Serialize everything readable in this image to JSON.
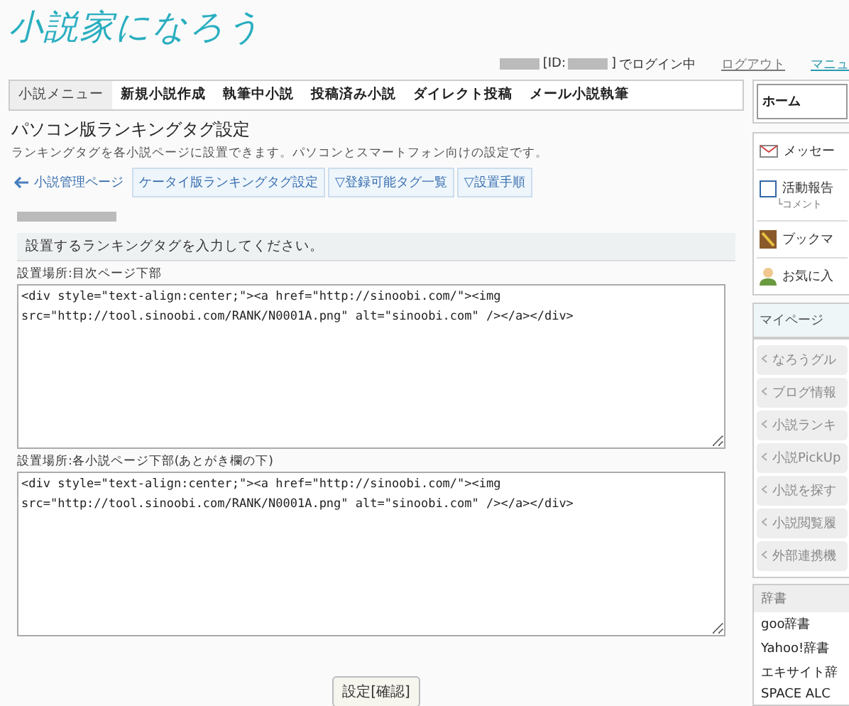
{
  "logo": "小説家になろう",
  "login": {
    "id_label": "[ID:",
    "id_close": "]",
    "status": "でログイン中",
    "links": [
      "ログアウト",
      "マニュ"
    ]
  },
  "nav": [
    {
      "label": "小説メニュー",
      "selected": true
    },
    {
      "label": "新規小説作成",
      "selected": false
    },
    {
      "label": "執筆中小説",
      "selected": false
    },
    {
      "label": "投稿済み小説",
      "selected": false
    },
    {
      "label": "ダイレクト投稿",
      "selected": false
    },
    {
      "label": "メール小説執筆",
      "selected": false
    }
  ],
  "title": "パソコン版ランキングタグ設定",
  "description": "ランキングタグを各小説ページに設置できます。パソコンとスマートフォン向けの設定です。",
  "back_link": "小説管理ページ",
  "sub_tabs": [
    "ケータイ版ランキングタグ設定",
    "▽登録可能タグ一覧",
    "▽設置手順"
  ],
  "section_heading": "設置するランキングタグを入力してください。",
  "fields": [
    {
      "label": "設置場所:目次ページ下部",
      "value": "<div style=\"text-align:center;\"><a href=\"http://sinoobi.com/\"><img src=\"http://tool.sinoobi.com/RANK/N0001A.png\" alt=\"sinoobi.com\" /></a></div>"
    },
    {
      "label": "設置場所:各小説ページ下部(あとがき欄の下)",
      "value": "<div style=\"text-align:center;\"><a href=\"http://sinoobi.com/\"><img src=\"http://tool.sinoobi.com/RANK/N0001A.png\" alt=\"sinoobi.com\" /></a></div>"
    }
  ],
  "submit": "設定[確認]",
  "sidebar": {
    "home": "ホーム",
    "account": [
      {
        "kind": "mail",
        "label": "メッセー"
      },
      {
        "kind": "activity",
        "label": "活動報告",
        "sub": "└コメント"
      },
      {
        "kind": "bookmark",
        "label": "ブックマ"
      },
      {
        "kind": "favorite",
        "label": "お気に入"
      }
    ],
    "mypage_heading": "マイページ",
    "mypage": [
      "なろうグル",
      "ブログ情報",
      "小説ランキ",
      "小説PickUp",
      "小説を探す",
      "小説閲覧履",
      "外部連携機"
    ],
    "dict_heading": "辞書",
    "dicts": [
      "goo辞書",
      "Yahoo!辞書",
      "エキサイト辞",
      "SPACE ALC"
    ]
  }
}
